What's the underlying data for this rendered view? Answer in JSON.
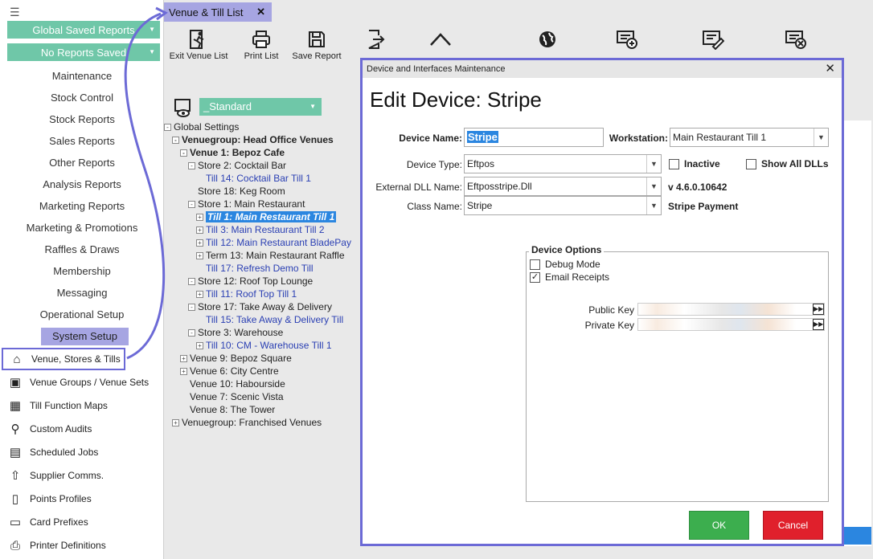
{
  "sidebar": {
    "dropdown_1": "Global Saved Reports",
    "dropdown_2": "No Reports Saved",
    "menu": [
      "Maintenance",
      "Stock Control",
      "Stock Reports",
      "Sales Reports",
      "Other Reports",
      "Analysis Reports",
      "Marketing Reports",
      "Marketing & Promotions",
      "Raffles & Draws",
      "Membership",
      "Messaging",
      "Operational Setup",
      "System Setup"
    ],
    "active_menu": "System Setup",
    "nav": [
      {
        "label": "Venue, Stores & Tills",
        "icon": "store-icon"
      },
      {
        "label": "Venue Groups / Venue Sets",
        "icon": "groups-icon"
      },
      {
        "label": "Till Function Maps",
        "icon": "grid-icon"
      },
      {
        "label": "Custom Audits",
        "icon": "audit-icon"
      },
      {
        "label": "Scheduled Jobs",
        "icon": "calendar-icon"
      },
      {
        "label": "Supplier Comms.",
        "icon": "upload-icon"
      },
      {
        "label": "Points Profiles",
        "icon": "document-icon"
      },
      {
        "label": "Card Prefixes",
        "icon": "card-icon"
      },
      {
        "label": "Printer Definitions",
        "icon": "printer-icon"
      }
    ]
  },
  "tab": {
    "label": "Venue & Till List"
  },
  "toolbar": {
    "exit": "Exit Venue List",
    "print": "Print List",
    "save": "Save Report"
  },
  "view_selector": "_Standard",
  "tree": [
    {
      "label": "Global Settings",
      "exp": "-",
      "level": 0
    },
    {
      "label": "Venuegroup: Head Office Venues",
      "exp": "-",
      "level": 1,
      "bold": true
    },
    {
      "label": "Venue 1: Bepoz Cafe",
      "exp": "-",
      "level": 2,
      "bold": true
    },
    {
      "label": "Store 2: Cocktail Bar",
      "exp": "-",
      "level": 3
    },
    {
      "label": "Till 14: Cocktail Bar Till 1",
      "exp": "",
      "level": 4,
      "blue": true
    },
    {
      "label": "Store 18: Keg Room",
      "exp": "",
      "level": 3
    },
    {
      "label": "Store 1: Main Restaurant",
      "exp": "-",
      "level": 3
    },
    {
      "label": "Till 1: Main Restaurant Till 1",
      "exp": "+",
      "level": 4,
      "blue": true,
      "selected": true
    },
    {
      "label": "Till 3: Main Restaurant Till 2",
      "exp": "+",
      "level": 4,
      "blue": true
    },
    {
      "label": "Till 12: Main Restaurant BladePay",
      "exp": "+",
      "level": 4,
      "blue": true
    },
    {
      "label": "Term 13: Main Restaurant Raffle",
      "exp": "+",
      "level": 4
    },
    {
      "label": "Till 17: Refresh Demo Till",
      "exp": "",
      "level": 4,
      "blue": true
    },
    {
      "label": "Store 12: Roof Top Lounge",
      "exp": "-",
      "level": 3
    },
    {
      "label": "Till 11: Roof Top Till 1",
      "exp": "+",
      "level": 4,
      "blue": true
    },
    {
      "label": "Store 17: Take Away & Delivery",
      "exp": "-",
      "level": 3
    },
    {
      "label": "Till 15: Take Away & Delivery Till",
      "exp": "",
      "level": 4,
      "blue": true
    },
    {
      "label": "Store 3: Warehouse",
      "exp": "-",
      "level": 3
    },
    {
      "label": "Till 10: CM - Warehouse Till 1",
      "exp": "+",
      "level": 4,
      "blue": true
    },
    {
      "label": "Venue 9: Bepoz Square",
      "exp": "+",
      "level": 2
    },
    {
      "label": "Venue 6: City Centre",
      "exp": "+",
      "level": 2
    },
    {
      "label": "Venue 10: Habourside",
      "exp": "",
      "level": 2
    },
    {
      "label": "Venue 7: Scenic Vista",
      "exp": "",
      "level": 2
    },
    {
      "label": "Venue 8: The Tower",
      "exp": "",
      "level": 2
    },
    {
      "label": "Venuegroup: Franchised Venues",
      "exp": "+",
      "level": 1
    }
  ],
  "dialog": {
    "window_title": "Device and Interfaces Maintenance",
    "heading": "Edit Device: Stripe",
    "device_name_label": "Device Name:",
    "device_name": "Stripe",
    "workstation_label": "Workstation:",
    "workstation": "Main Restaurant Till 1",
    "device_type_label": "Device Type:",
    "device_type": "Eftpos",
    "inactive_label": "Inactive",
    "show_all_dlls_label": "Show All DLLs",
    "external_dll_label": "External DLL Name:",
    "external_dll": "Eftposstripe.Dll",
    "version": "v 4.6.0.10642",
    "class_name_label": "Class Name:",
    "class_name": "Stripe",
    "class_description": "Stripe Payment",
    "device_options_title": "Device Options",
    "debug_mode_label": "Debug Mode",
    "debug_mode_checked": false,
    "email_receipts_label": "Email Receipts",
    "email_receipts_checked": true,
    "public_key_label": "Public Key",
    "private_key_label": "Private Key",
    "ok_label": "OK",
    "cancel_label": "Cancel"
  },
  "colors": {
    "accent": "#6c6ad6",
    "menu_highlight": "#a6a5e2",
    "green": "#6fc7a8",
    "ok": "#3cae4e",
    "cancel": "#e0202c",
    "selection": "#2b86e0"
  }
}
